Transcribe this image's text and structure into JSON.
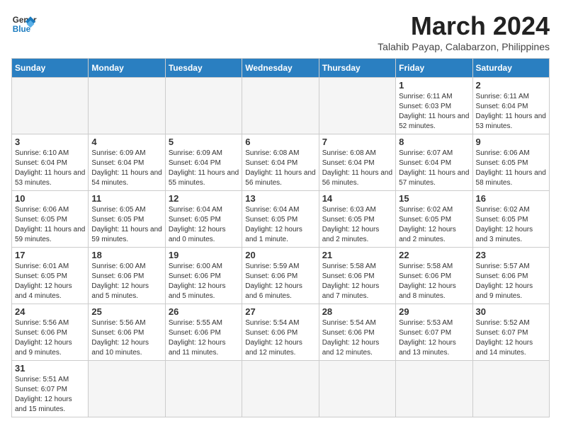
{
  "header": {
    "logo_line1": "General",
    "logo_line2": "Blue",
    "title": "March 2024",
    "subtitle": "Talahib Payap, Calabarzon, Philippines"
  },
  "weekdays": [
    "Sunday",
    "Monday",
    "Tuesday",
    "Wednesday",
    "Thursday",
    "Friday",
    "Saturday"
  ],
  "weeks": [
    [
      {
        "day": "",
        "info": ""
      },
      {
        "day": "",
        "info": ""
      },
      {
        "day": "",
        "info": ""
      },
      {
        "day": "",
        "info": ""
      },
      {
        "day": "",
        "info": ""
      },
      {
        "day": "1",
        "info": "Sunrise: 6:11 AM\nSunset: 6:03 PM\nDaylight: 11 hours and 52 minutes."
      },
      {
        "day": "2",
        "info": "Sunrise: 6:11 AM\nSunset: 6:04 PM\nDaylight: 11 hours and 53 minutes."
      }
    ],
    [
      {
        "day": "3",
        "info": "Sunrise: 6:10 AM\nSunset: 6:04 PM\nDaylight: 11 hours and 53 minutes."
      },
      {
        "day": "4",
        "info": "Sunrise: 6:09 AM\nSunset: 6:04 PM\nDaylight: 11 hours and 54 minutes."
      },
      {
        "day": "5",
        "info": "Sunrise: 6:09 AM\nSunset: 6:04 PM\nDaylight: 11 hours and 55 minutes."
      },
      {
        "day": "6",
        "info": "Sunrise: 6:08 AM\nSunset: 6:04 PM\nDaylight: 11 hours and 56 minutes."
      },
      {
        "day": "7",
        "info": "Sunrise: 6:08 AM\nSunset: 6:04 PM\nDaylight: 11 hours and 56 minutes."
      },
      {
        "day": "8",
        "info": "Sunrise: 6:07 AM\nSunset: 6:04 PM\nDaylight: 11 hours and 57 minutes."
      },
      {
        "day": "9",
        "info": "Sunrise: 6:06 AM\nSunset: 6:05 PM\nDaylight: 11 hours and 58 minutes."
      }
    ],
    [
      {
        "day": "10",
        "info": "Sunrise: 6:06 AM\nSunset: 6:05 PM\nDaylight: 11 hours and 59 minutes."
      },
      {
        "day": "11",
        "info": "Sunrise: 6:05 AM\nSunset: 6:05 PM\nDaylight: 11 hours and 59 minutes."
      },
      {
        "day": "12",
        "info": "Sunrise: 6:04 AM\nSunset: 6:05 PM\nDaylight: 12 hours and 0 minutes."
      },
      {
        "day": "13",
        "info": "Sunrise: 6:04 AM\nSunset: 6:05 PM\nDaylight: 12 hours and 1 minute."
      },
      {
        "day": "14",
        "info": "Sunrise: 6:03 AM\nSunset: 6:05 PM\nDaylight: 12 hours and 2 minutes."
      },
      {
        "day": "15",
        "info": "Sunrise: 6:02 AM\nSunset: 6:05 PM\nDaylight: 12 hours and 2 minutes."
      },
      {
        "day": "16",
        "info": "Sunrise: 6:02 AM\nSunset: 6:05 PM\nDaylight: 12 hours and 3 minutes."
      }
    ],
    [
      {
        "day": "17",
        "info": "Sunrise: 6:01 AM\nSunset: 6:05 PM\nDaylight: 12 hours and 4 minutes."
      },
      {
        "day": "18",
        "info": "Sunrise: 6:00 AM\nSunset: 6:06 PM\nDaylight: 12 hours and 5 minutes."
      },
      {
        "day": "19",
        "info": "Sunrise: 6:00 AM\nSunset: 6:06 PM\nDaylight: 12 hours and 5 minutes."
      },
      {
        "day": "20",
        "info": "Sunrise: 5:59 AM\nSunset: 6:06 PM\nDaylight: 12 hours and 6 minutes."
      },
      {
        "day": "21",
        "info": "Sunrise: 5:58 AM\nSunset: 6:06 PM\nDaylight: 12 hours and 7 minutes."
      },
      {
        "day": "22",
        "info": "Sunrise: 5:58 AM\nSunset: 6:06 PM\nDaylight: 12 hours and 8 minutes."
      },
      {
        "day": "23",
        "info": "Sunrise: 5:57 AM\nSunset: 6:06 PM\nDaylight: 12 hours and 9 minutes."
      }
    ],
    [
      {
        "day": "24",
        "info": "Sunrise: 5:56 AM\nSunset: 6:06 PM\nDaylight: 12 hours and 9 minutes."
      },
      {
        "day": "25",
        "info": "Sunrise: 5:56 AM\nSunset: 6:06 PM\nDaylight: 12 hours and 10 minutes."
      },
      {
        "day": "26",
        "info": "Sunrise: 5:55 AM\nSunset: 6:06 PM\nDaylight: 12 hours and 11 minutes."
      },
      {
        "day": "27",
        "info": "Sunrise: 5:54 AM\nSunset: 6:06 PM\nDaylight: 12 hours and 12 minutes."
      },
      {
        "day": "28",
        "info": "Sunrise: 5:54 AM\nSunset: 6:06 PM\nDaylight: 12 hours and 12 minutes."
      },
      {
        "day": "29",
        "info": "Sunrise: 5:53 AM\nSunset: 6:07 PM\nDaylight: 12 hours and 13 minutes."
      },
      {
        "day": "30",
        "info": "Sunrise: 5:52 AM\nSunset: 6:07 PM\nDaylight: 12 hours and 14 minutes."
      }
    ],
    [
      {
        "day": "31",
        "info": "Sunrise: 5:51 AM\nSunset: 6:07 PM\nDaylight: 12 hours and 15 minutes."
      },
      {
        "day": "",
        "info": ""
      },
      {
        "day": "",
        "info": ""
      },
      {
        "day": "",
        "info": ""
      },
      {
        "day": "",
        "info": ""
      },
      {
        "day": "",
        "info": ""
      },
      {
        "day": "",
        "info": ""
      }
    ]
  ]
}
